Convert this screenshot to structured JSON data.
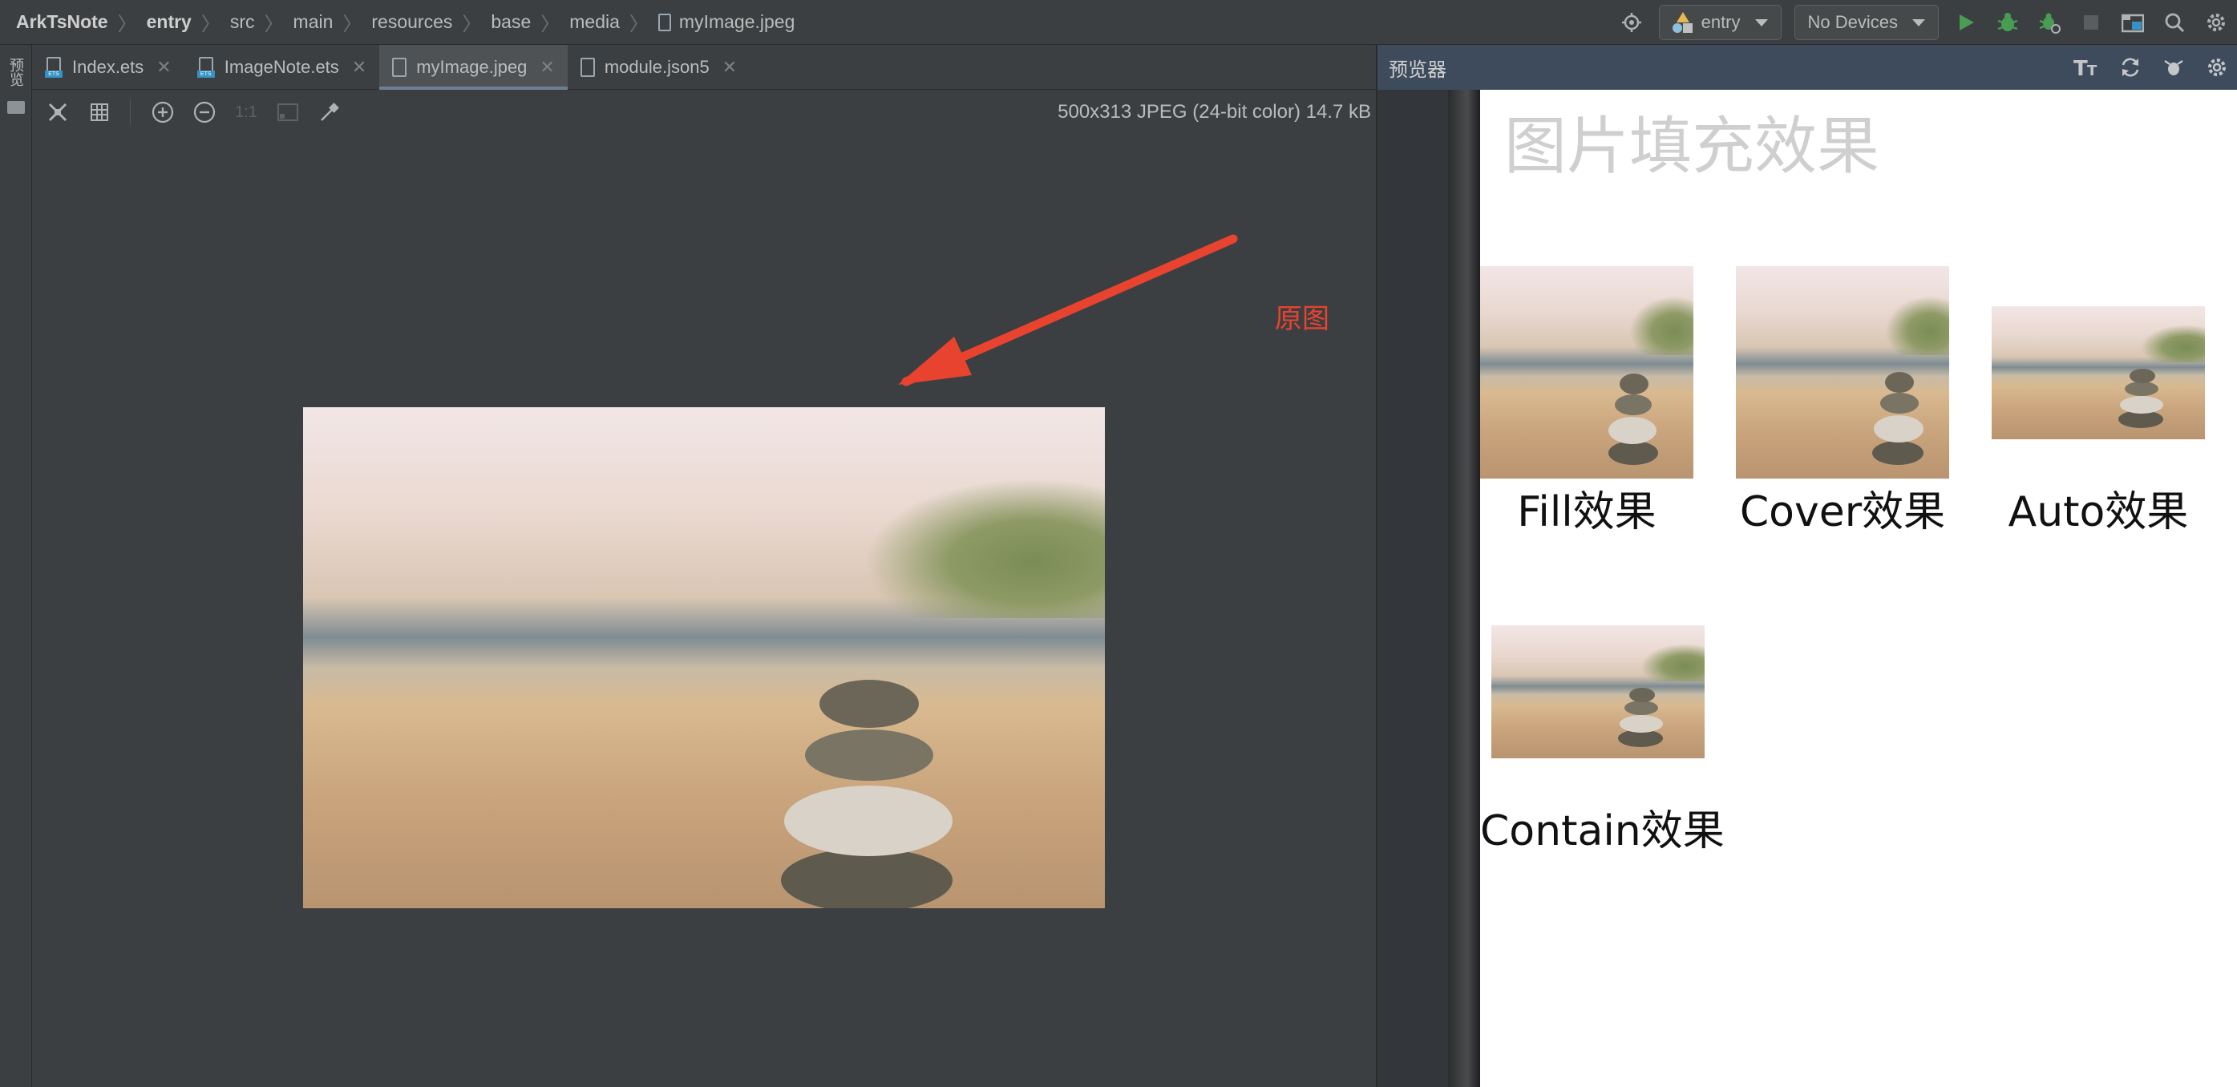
{
  "breadcrumb": {
    "items": [
      "ArkTsNote",
      "entry",
      "src",
      "main",
      "resources",
      "base",
      "media",
      "myImage.jpeg"
    ]
  },
  "toolbar": {
    "module_selector": "entry",
    "device_selector": "No Devices",
    "icons": [
      "target-icon",
      "run-icon",
      "debug-icon",
      "attach-debugger-icon",
      "stop-icon",
      "project-structure-icon",
      "search-icon",
      "settings-icon"
    ]
  },
  "left_strip": {
    "vertical_tab": "预览"
  },
  "tabs": [
    {
      "label": "Index.ets",
      "icon": "ets-file-icon",
      "active": false
    },
    {
      "label": "ImageNote.ets",
      "icon": "ets-file-icon",
      "active": false
    },
    {
      "label": "myImage.jpeg",
      "icon": "image-file-icon",
      "active": true
    },
    {
      "label": "module.json5",
      "icon": "json-file-icon",
      "active": false
    }
  ],
  "viewer_toolbar": {
    "actual_size_label": "1:1",
    "image_info": "500x313 JPEG (24-bit color) 14.7 kB"
  },
  "annotation": {
    "label": "原图",
    "color": "#e8432e"
  },
  "preview": {
    "title": "预览器",
    "heading": "图片填充效果",
    "captions": {
      "fill": "Fill效果",
      "cover": "Cover效果",
      "auto": "Auto效果",
      "contain": "Contain效果"
    }
  }
}
